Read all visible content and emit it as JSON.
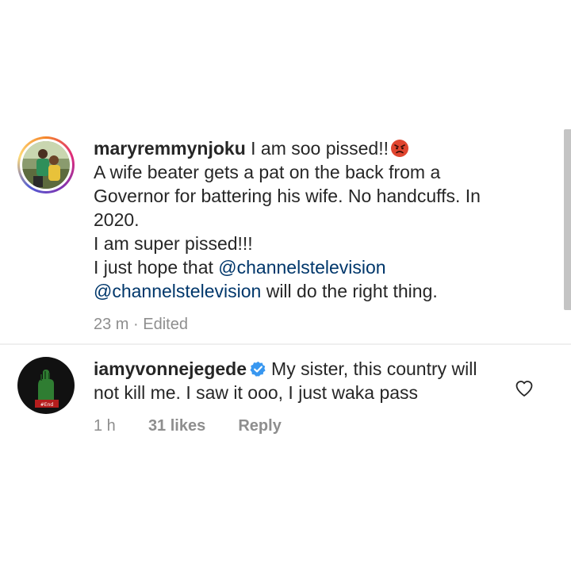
{
  "comments": [
    {
      "username": "maryremmynjoku",
      "first_line_text": "I am soo pissed!!",
      "emoji": "angry-face-icon",
      "lines": [
        "A wife beater gets a pat on the back from a",
        "Governor for battering his wife. No handcuffs.  In",
        "2020.",
        "I am super pissed!!!"
      ],
      "hope_text": "I just hope that",
      "mention_1": "@channelstelevision",
      "mention_2": "@channelstelevision",
      "closing_text": "will do the right thing.",
      "time": "23 m",
      "separator": "·",
      "edited_label": "Edited",
      "has_story_ring": true
    },
    {
      "username": "iamyvonnejegede",
      "verified": true,
      "text_line_1": "My sister, this country will",
      "text_line_2": "not kill me. I saw it ooo, I just waka pass",
      "time": "1 h",
      "likes": "31 likes",
      "reply_label": "Reply",
      "avatar_badge_text": "#End"
    }
  ],
  "colors": {
    "mention": "#00376b",
    "meta": "#8e8e8e",
    "verified": "#3897f0",
    "text": "#262626"
  }
}
